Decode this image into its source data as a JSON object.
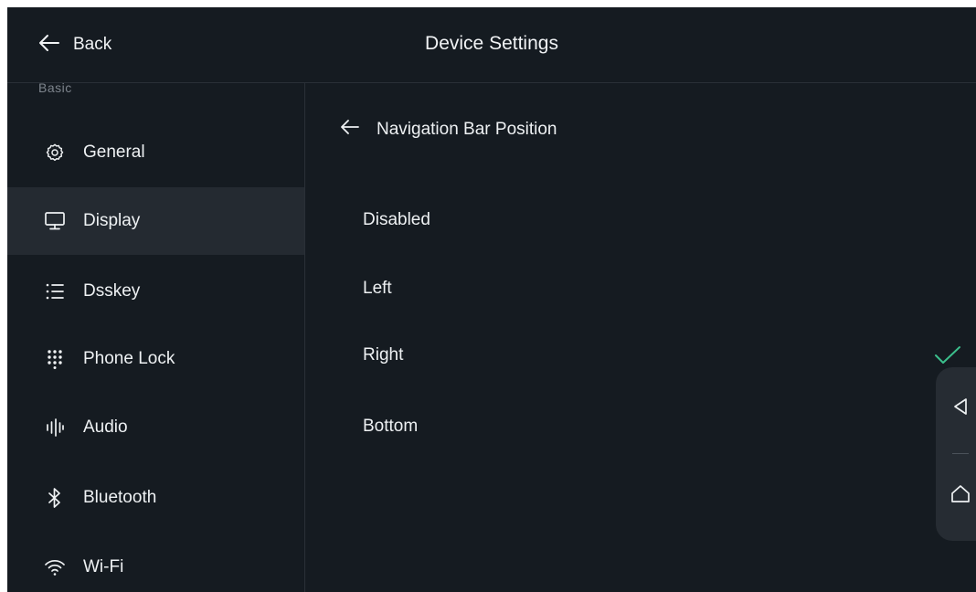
{
  "header": {
    "back_label": "Back",
    "title": "Device Settings"
  },
  "sidebar": {
    "section_label": "Basic",
    "items": [
      {
        "label": "General",
        "icon": "gear-icon",
        "active": false
      },
      {
        "label": "Display",
        "icon": "monitor-icon",
        "active": true
      },
      {
        "label": "Dsskey",
        "icon": "list-icon",
        "active": false
      },
      {
        "label": "Phone Lock",
        "icon": "keypad-icon",
        "active": false
      },
      {
        "label": "Audio",
        "icon": "audio-bars-icon",
        "active": false
      },
      {
        "label": "Bluetooth",
        "icon": "bluetooth-icon",
        "active": false
      },
      {
        "label": "Wi-Fi",
        "icon": "wifi-icon",
        "active": false
      }
    ]
  },
  "main": {
    "sub_title": "Navigation Bar Position",
    "options": [
      {
        "label": "Disabled",
        "selected": false
      },
      {
        "label": "Left",
        "selected": false
      },
      {
        "label": "Right",
        "selected": true
      },
      {
        "label": "Bottom",
        "selected": false
      }
    ]
  },
  "floating_nav": {
    "buttons": [
      "back-triangle-icon",
      "home-icon"
    ]
  },
  "colors": {
    "background": "#151b21",
    "active_item": "#242a31",
    "check": "#3bbf8c",
    "text": "#eef1f3",
    "muted": "#7d848c"
  }
}
